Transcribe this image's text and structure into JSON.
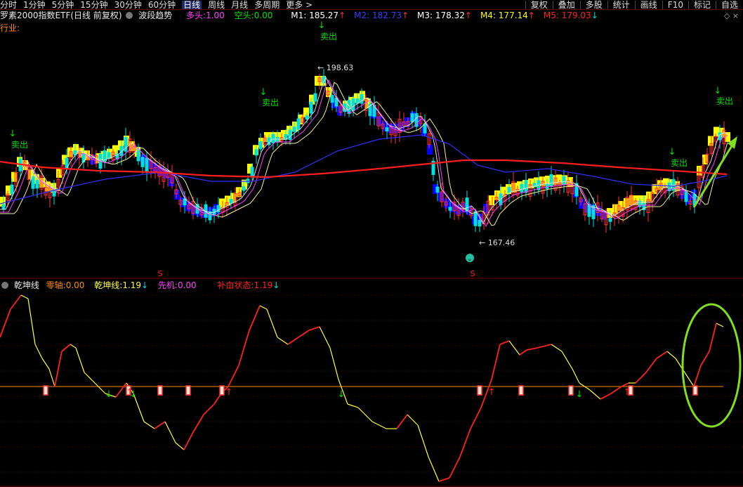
{
  "periods": [
    "分时",
    "1分钟",
    "5分钟",
    "15分钟",
    "30分钟",
    "60分钟",
    "日线",
    "周线",
    "月线",
    "多周期",
    "更多 >"
  ],
  "active_period": "日线",
  "right_tools": [
    "复权",
    "叠加",
    "多股",
    "统计",
    "画线",
    "F10",
    "标记",
    "自选"
  ],
  "main_title": "罗素2000指数ETF(日线 前复权)",
  "indicator_name": "波段趋势",
  "bull": {
    "label": "多头:",
    "value": "1.00",
    "color": "#ff40ff"
  },
  "bear": {
    "label": "空头:",
    "value": "0.00",
    "color": "#00e000"
  },
  "ma": [
    {
      "label": "M1:",
      "value": "185.27",
      "arrow": "↑",
      "color": "#ffffff"
    },
    {
      "label": "M2:",
      "value": "182.73",
      "arrow": "↑",
      "color": "#3b3bff"
    },
    {
      "label": "M3:",
      "value": "178.32",
      "arrow": "↑",
      "color": "#ffffff"
    },
    {
      "label": "M4:",
      "value": "177.14",
      "arrow": "↑",
      "color": "#ffff00"
    },
    {
      "label": "M5:",
      "value": "179.03",
      "arrow": "↓",
      "color": "#ff2020"
    }
  ],
  "industry_label": "行业:",
  "win_icons": "◇ ×",
  "sell_label": "卖出",
  "high_label": "198.63",
  "low_label": "167.46",
  "s_marker": "S",
  "sub": {
    "name": "乾坤线",
    "zero": {
      "label": "零轴:",
      "value": "0.00",
      "color": "#ff8c00"
    },
    "qk": {
      "label": "乾坤线:",
      "value": "1.19",
      "arrow": "↓",
      "color": "#ffff40"
    },
    "xj": {
      "label": "先机:",
      "value": "0.00",
      "color": "#ff40ff"
    },
    "bx": {
      "label": "补血状态:",
      "value": "1.19",
      "arrow": "↓",
      "color": "#ff2020"
    }
  },
  "colors": {
    "up": "#ff3232",
    "down": "#00e0e0",
    "ma5": "#ff1e1e",
    "ma2": "#2828ff",
    "band_bull": "#ffff00",
    "band_bear": "#0000ff",
    "zero_line": "#ff8c00",
    "sub_up": "#ff2020",
    "sub_down": "#ffff40",
    "annot": "#80e020"
  }
}
